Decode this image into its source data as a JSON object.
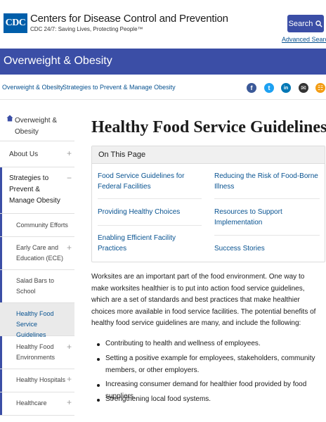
{
  "header": {
    "logo_text": "CDC",
    "org_name": "Centers for Disease Control and Prevention",
    "tagline": "CDC 24/7: Saving Lives, Protecting People™",
    "search_label": "Search",
    "advanced_search": "Advanced Search"
  },
  "site_title": "Overweight & Obesity",
  "breadcrumb": {
    "items": [
      "Overweight & Obesity",
      "Strategies to Prevent & Manage Obesity"
    ],
    "separator": ">"
  },
  "share_icons": [
    {
      "name": "facebook-icon",
      "glyph": "f",
      "color": "#3b5998"
    },
    {
      "name": "twitter-icon",
      "glyph": "t",
      "color": "#1da1f2"
    },
    {
      "name": "linkedin-icon",
      "glyph": "in",
      "color": "#0077b5"
    },
    {
      "name": "email-icon",
      "glyph": "✉",
      "color": "#333333"
    },
    {
      "name": "syndicate-icon",
      "glyph": "☷",
      "color": "#f39c12"
    }
  ],
  "sidebar": {
    "home": "Overweight & Obesity",
    "items": [
      {
        "label": "About Us",
        "toggle": "+"
      },
      {
        "label": "Strategies to Prevent & Manage Obesity",
        "toggle": "−"
      },
      {
        "label": "Community Efforts",
        "toggle": ""
      },
      {
        "label": "Early Care and Education (ECE)",
        "toggle": "+"
      },
      {
        "label": "Salad Bars to School",
        "toggle": ""
      },
      {
        "label": "Healthy Food Service Guidelines",
        "toggle": ""
      },
      {
        "label": "Healthy Food Environments",
        "toggle": "+"
      },
      {
        "label": "Healthy Hospitals",
        "toggle": "+"
      },
      {
        "label": "Healthcare",
        "toggle": "+"
      }
    ]
  },
  "main": {
    "title": "Healthy Food Service Guidelines",
    "on_this_page": {
      "heading": "On This Page",
      "links_left": [
        "Food Service Guidelines for Federal Facilities",
        "Providing Healthy Choices",
        "Enabling Efficient Facility Practices"
      ],
      "links_right": [
        "Reducing the Risk of Food-Borne Illness",
        "Resources to Support Implementation",
        "Success Stories"
      ]
    },
    "intro": "Worksites are an important part of the food environment. One way to make worksites healthier is to put into action food service guidelines, which are a set of standards and best practices that make healthier choices more available in food service facilities. The potential benefits of healthy food service guidelines are many, and include the following:",
    "bullets": [
      "Contributing to health and wellness of employees.",
      "Setting a positive example for employees, stakeholders, community members, or other employers.",
      "Increasing consumer demand for healthier food provided by food suppliers.",
      "Strengthening local food systems."
    ]
  },
  "colors": {
    "brand_blue": "#3b4ea6",
    "link_blue": "#075290",
    "logo_blue": "#005eaa"
  }
}
